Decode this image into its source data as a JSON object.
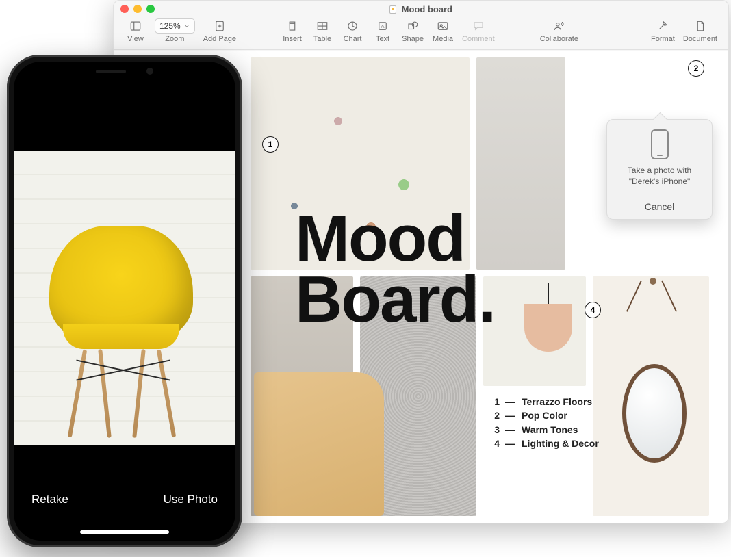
{
  "window": {
    "title": "Mood board"
  },
  "toolbar": {
    "view": "View",
    "zoom": "Zoom",
    "zoom_value": "125%",
    "add_page": "Add Page",
    "insert": "Insert",
    "table": "Table",
    "chart": "Chart",
    "text": "Text",
    "shape": "Shape",
    "media": "Media",
    "comment": "Comment",
    "collaborate": "Collaborate",
    "format": "Format",
    "document": "Document"
  },
  "canvas": {
    "page_title_line1": "Mood",
    "page_title_line2": "Board.",
    "callouts": {
      "c1": "1",
      "c2": "2",
      "c4": "4"
    },
    "notes": [
      {
        "num": "1",
        "label": "Terrazzo Floors"
      },
      {
        "num": "2",
        "label": "Pop Color"
      },
      {
        "num": "3",
        "label": "Warm Tones"
      },
      {
        "num": "4",
        "label": "Lighting & Decor"
      }
    ]
  },
  "popover": {
    "text_line1": "Take a photo with",
    "text_line2": "\"Derek's iPhone\"",
    "cancel": "Cancel"
  },
  "iphone": {
    "retake": "Retake",
    "use_photo": "Use Photo"
  }
}
